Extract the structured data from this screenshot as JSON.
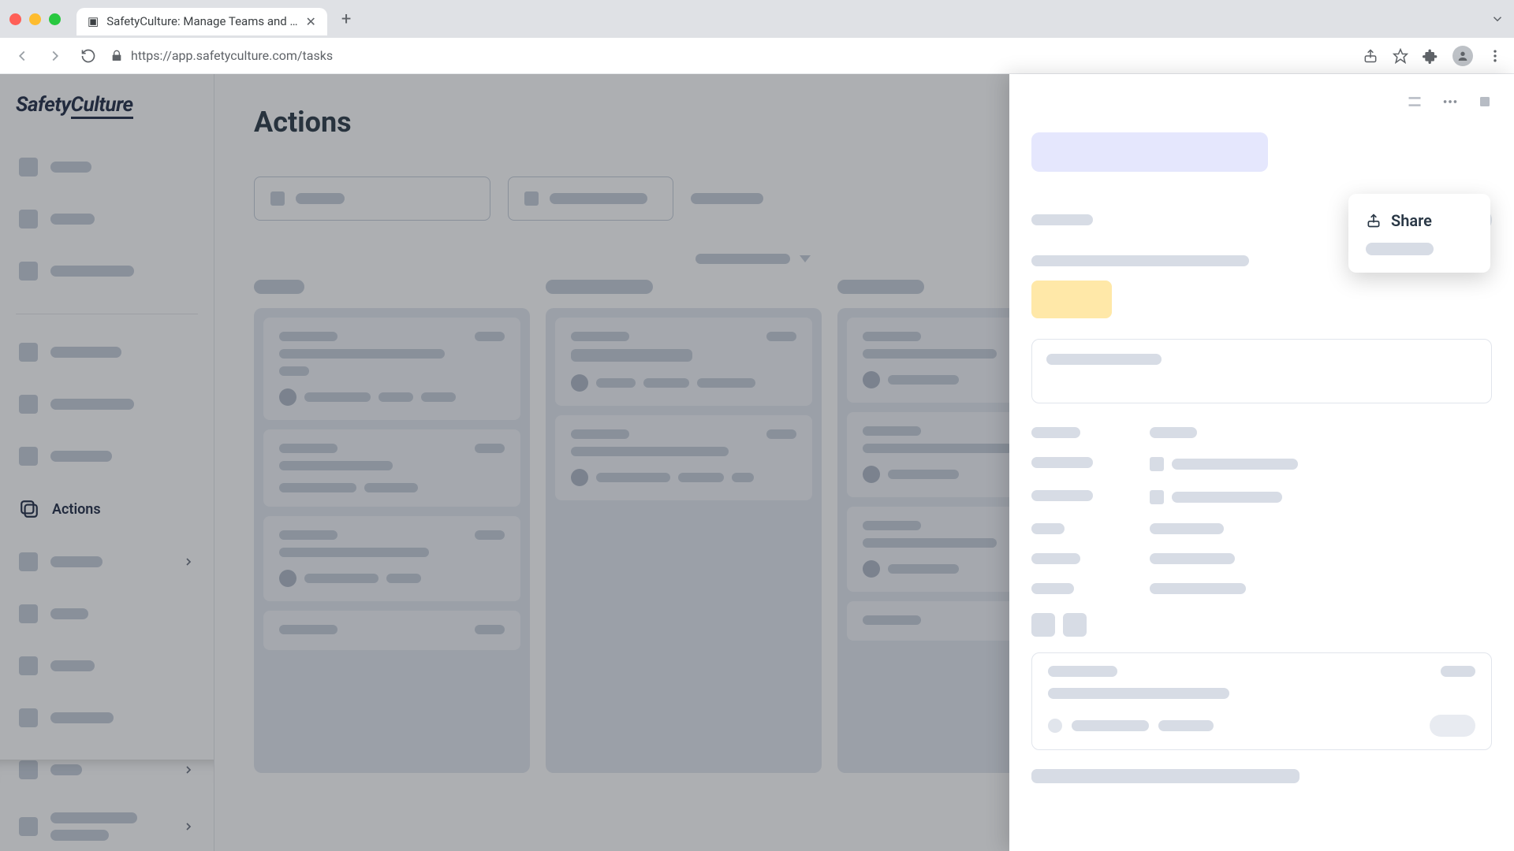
{
  "browser": {
    "tab_title": "SafetyCulture: Manage Teams and …",
    "url": "https://app.safetyculture.com/tasks"
  },
  "logo": {
    "brand_a": "Safety",
    "brand_b": "Culture"
  },
  "page": {
    "title": "Actions"
  },
  "sidebar": {
    "active_label": "Actions"
  },
  "share_menu": {
    "share_label": "Share"
  }
}
